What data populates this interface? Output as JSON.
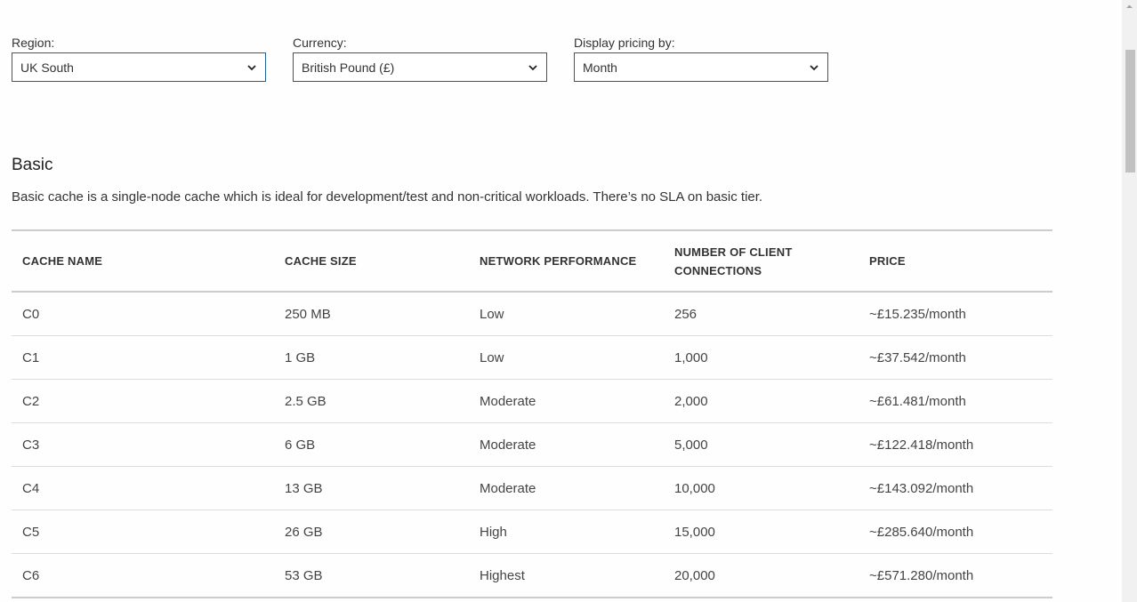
{
  "filters": [
    {
      "label": "Region:",
      "value": "UK South"
    },
    {
      "label": "Currency:",
      "value": "British Pound (£)"
    },
    {
      "label": "Display pricing by:",
      "value": "Month"
    }
  ],
  "section": {
    "title": "Basic",
    "description": "Basic cache is a single-node cache which is ideal for development/test and non-critical workloads. There’s no SLA on basic tier."
  },
  "table": {
    "headers": [
      "CACHE NAME",
      "CACHE SIZE",
      "NETWORK PERFORMANCE",
      "NUMBER OF CLIENT CONNECTIONS",
      "PRICE"
    ],
    "rows": [
      [
        "C0",
        "250 MB",
        "Low",
        "256",
        "~£15.235/month"
      ],
      [
        "C1",
        "1 GB",
        "Low",
        "1,000",
        "~£37.542/month"
      ],
      [
        "C2",
        "2.5 GB",
        "Moderate",
        "2,000",
        "~£61.481/month"
      ],
      [
        "C3",
        "6 GB",
        "Moderate",
        "5,000",
        "~£122.418/month"
      ],
      [
        "C4",
        "13 GB",
        "Moderate",
        "10,000",
        "~£143.092/month"
      ],
      [
        "C5",
        "26 GB",
        "High",
        "15,000",
        "~£285.640/month"
      ],
      [
        "C6",
        "53 GB",
        "Highest",
        "20,000",
        "~£571.280/month"
      ]
    ]
  },
  "colors": {
    "focus_border": "#1f5f99",
    "select_border": "#505050",
    "divider": "#cccccc"
  }
}
